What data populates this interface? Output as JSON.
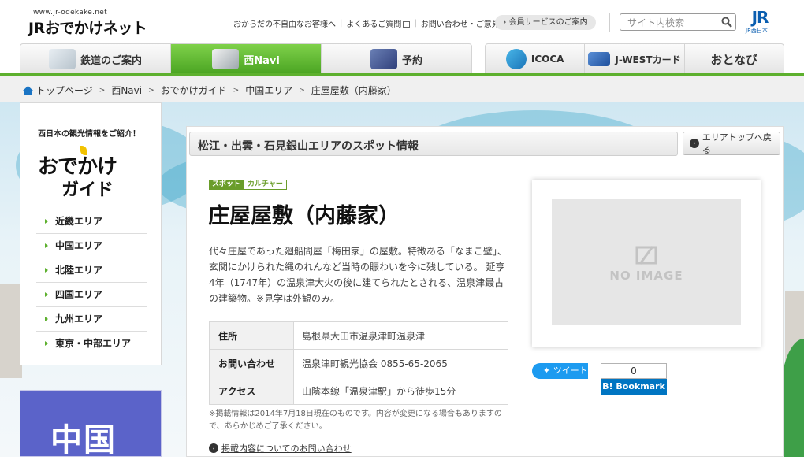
{
  "header": {
    "logo_url": "www.jr-odekake.net",
    "logo_name": "JRおでかけネット",
    "toplinks": [
      "おからだの不自由なお客様へ",
      "よくあるご質問",
      "お問い合わせ・ご意見"
    ],
    "member_button": "会員サービスのご案内",
    "search_placeholder": "サイト内検索",
    "jr_logo": "JR",
    "jr_sub": "JR西日本"
  },
  "nav": {
    "main": [
      {
        "label": "鉄道のご案内",
        "active": false
      },
      {
        "label": "西Navi",
        "active": true
      },
      {
        "label": "予約",
        "active": false
      }
    ],
    "sub": [
      {
        "label": "ICOCA"
      },
      {
        "label": "J-WESTカード"
      },
      {
        "label": "おとなび"
      }
    ]
  },
  "breadcrumb": {
    "items": [
      "トップページ",
      "西Navi",
      "おでかけガイド",
      "中国エリア"
    ],
    "current": "庄屋屋敷（内藤家）"
  },
  "sidebar": {
    "catch": "西日本の観光情報をご紹介！",
    "title_line1": "おでかけ",
    "title_line2": "ガイド",
    "areas": [
      "近畿エリア",
      "中国エリア",
      "北陸エリア",
      "四国エリア",
      "九州エリア",
      "東京・中部エリア"
    ],
    "region_banner": "中国"
  },
  "main": {
    "area_heading": "松江・出雲・石見銀山エリアのスポット情報",
    "back_button": "エリアトップへ戻る",
    "tag_spot": "スポット",
    "tag_category": "カルチャー",
    "title": "庄屋屋敷（内藤家）",
    "description": "代々庄屋であった廻船問屋「梅田家」の屋敷。特徴ある「なまこ壁」、玄関にかけられた縄のれんなど当時の賑わいを今に残している。 延亨4年（1747年）の温泉津大火の後に建てられたとされる、温泉津最古の建築物。※見学は外観のみ。",
    "info": [
      {
        "label": "住所",
        "value": "島根県大田市温泉津町温泉津"
      },
      {
        "label": "お問い合わせ",
        "value": "温泉津町観光協会 0855-65-2065"
      },
      {
        "label": "アクセス",
        "value": "山陰本線「温泉津駅」から徒歩15分"
      }
    ],
    "note": "※掲載情報は2014年7月18日現在のものです。内容が変更になる場合もありますので、あらかじめご了承ください。",
    "inquiry_link": "掲載内容についてのお問い合わせ",
    "no_image": "NO IMAGE",
    "tweet_label": "ツイート",
    "bookmark_count": "0",
    "bookmark_label": "B! Bookmark"
  },
  "colors": {
    "accent_green": "#5db02e",
    "jr_blue": "#0a5eb0",
    "region_purple": "#5b63c9"
  }
}
